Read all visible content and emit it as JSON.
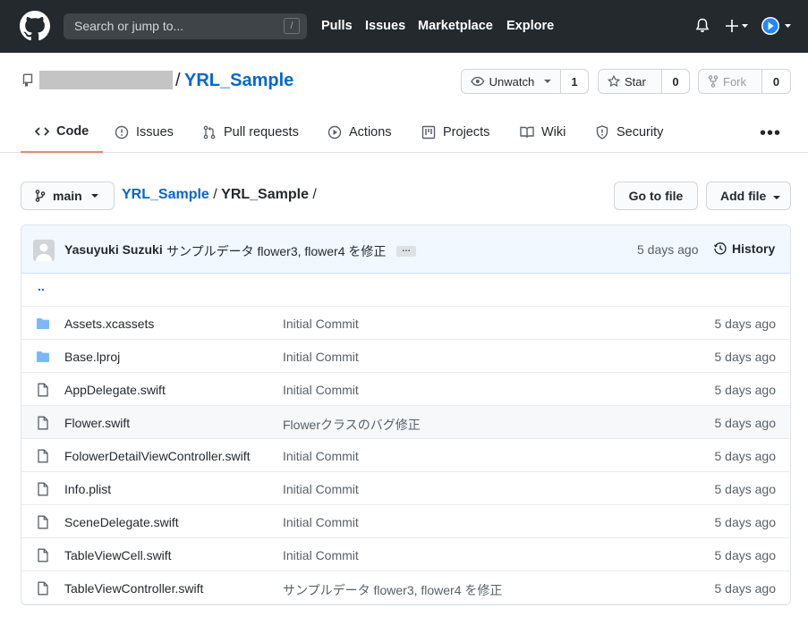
{
  "header": {
    "search_placeholder": "Search or jump to...",
    "search_shortcut": "/",
    "nav": [
      "Pulls",
      "Issues",
      "Marketplace",
      "Explore"
    ]
  },
  "repo": {
    "slash": "/",
    "name": "YRL_Sample",
    "unwatch_label": "Unwatch",
    "unwatch_count": "1",
    "star_label": "Star",
    "star_count": "0",
    "fork_label": "Fork",
    "fork_count": "0"
  },
  "tabs": [
    {
      "label": "Code",
      "icon": "code-icon"
    },
    {
      "label": "Issues",
      "icon": "issue-icon"
    },
    {
      "label": "Pull requests",
      "icon": "pull-request-icon"
    },
    {
      "label": "Actions",
      "icon": "play-icon"
    },
    {
      "label": "Projects",
      "icon": "project-icon"
    },
    {
      "label": "Wiki",
      "icon": "book-icon"
    },
    {
      "label": "Security",
      "icon": "shield-icon"
    }
  ],
  "more_label": "•••",
  "branch": {
    "name": "main",
    "crumb_repo": "YRL_Sample",
    "crumb_sep": " / ",
    "crumb_dir": "YRL_Sample",
    "crumb_trail": " /",
    "go_to_file": "Go to file",
    "add_file": "Add file"
  },
  "commit": {
    "author": "Yasuyuki Suzuki",
    "message": "サンプルデータ flower3, flower4 を修正",
    "ellipsis": "…",
    "time": "5 days ago",
    "history": "History"
  },
  "updir": "..",
  "files": [
    {
      "type": "dir",
      "name": "Assets.xcassets",
      "message": "Initial Commit",
      "time": "5 days ago"
    },
    {
      "type": "dir",
      "name": "Base.lproj",
      "message": "Initial Commit",
      "time": "5 days ago"
    },
    {
      "type": "file",
      "name": "AppDelegate.swift",
      "message": "Initial Commit",
      "time": "5 days ago"
    },
    {
      "type": "file",
      "name": "Flower.swift",
      "message": "Flowerクラスのバグ修正",
      "time": "5 days ago"
    },
    {
      "type": "file",
      "name": "FolowerDetailViewController.swift",
      "message": "Initial Commit",
      "time": "5 days ago"
    },
    {
      "type": "file",
      "name": "Info.plist",
      "message": "Initial Commit",
      "time": "5 days ago"
    },
    {
      "type": "file",
      "name": "SceneDelegate.swift",
      "message": "Initial Commit",
      "time": "5 days ago"
    },
    {
      "type": "file",
      "name": "TableViewCell.swift",
      "message": "Initial Commit",
      "time": "5 days ago"
    },
    {
      "type": "file",
      "name": "TableViewController.swift",
      "message": "サンプルデータ flower3, flower4 を修正",
      "time": "5 days ago"
    }
  ],
  "colors": {
    "header_bg": "#24292e",
    "link": "#0366d6",
    "tab_underline": "#f9826c",
    "folder": "#79b8ff",
    "commit_bar": "#f1f8ff"
  }
}
